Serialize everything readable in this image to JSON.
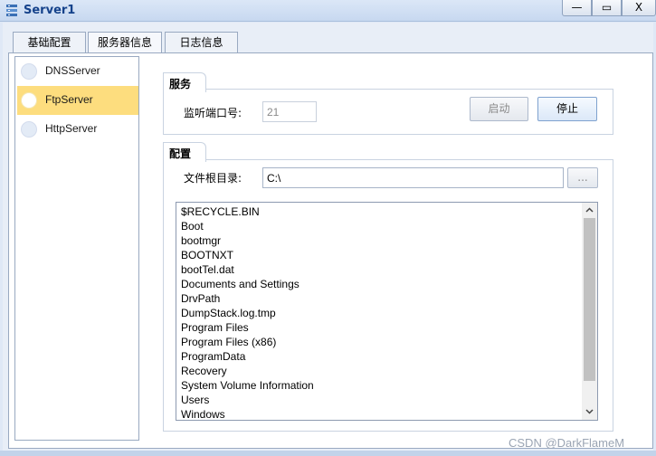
{
  "window": {
    "title": "Server1",
    "icon": "server-icon",
    "buttons": {
      "minimize": "—",
      "maximize": "▭",
      "close": "X"
    }
  },
  "tabs": [
    {
      "label": "基础配置",
      "active": false
    },
    {
      "label": "服务器信息",
      "active": true
    },
    {
      "label": "日志信息",
      "active": false
    }
  ],
  "sidebar": {
    "items": [
      {
        "label": "DNSServer",
        "selected": false
      },
      {
        "label": "FtpServer",
        "selected": true
      },
      {
        "label": "HttpServer",
        "selected": false
      }
    ]
  },
  "service": {
    "group_title": "服务",
    "port_label": "监听端口号:",
    "port_value": "21",
    "start_label": "启动",
    "stop_label": "停止"
  },
  "config": {
    "group_title": "配置",
    "root_label": "文件根目录:",
    "root_value": "C:\\",
    "browse_label": "..."
  },
  "files": [
    "$RECYCLE.BIN",
    "Boot",
    "bootmgr",
    "BOOTNXT",
    "bootTel.dat",
    "Documents and Settings",
    "DrvPath",
    "DumpStack.log.tmp",
    "Program Files",
    "Program Files (x86)",
    "ProgramData",
    "Recovery",
    "System Volume Information",
    "Users",
    "Windows"
  ],
  "watermark": "CSDN @DarkFlameM",
  "colors": {
    "selected": "#fddd7e",
    "title": "#15428b"
  }
}
